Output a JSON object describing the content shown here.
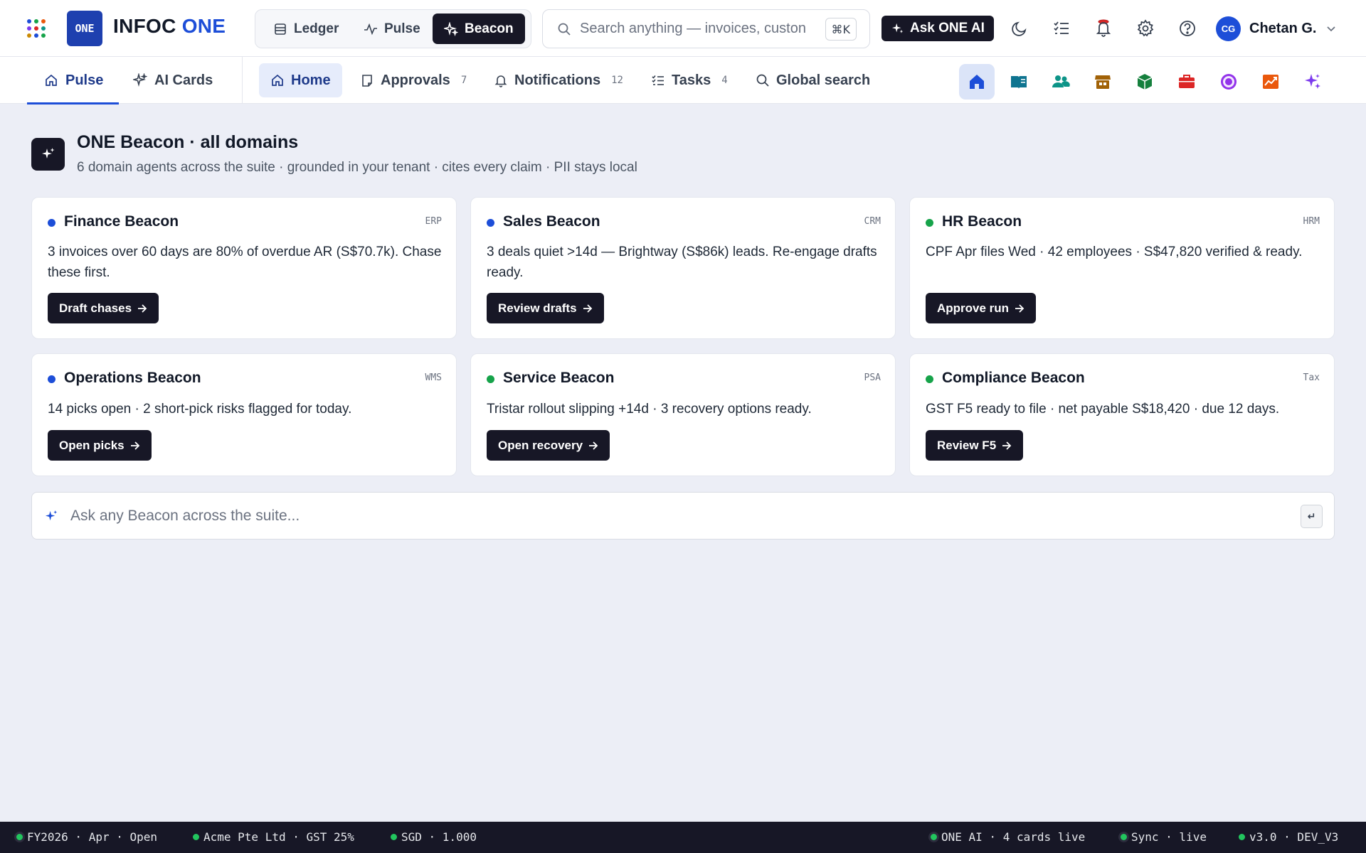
{
  "topbar": {
    "brand_main": "INFOC ",
    "brand_accent": "ONE",
    "logo_text": "ONE",
    "modes": [
      {
        "label": "Ledger",
        "icon": "ledger-icon",
        "active": false
      },
      {
        "label": "Pulse",
        "icon": "pulse-icon",
        "active": false
      },
      {
        "label": "Beacon",
        "icon": "sparkle-icon",
        "active": true
      }
    ],
    "search_placeholder": "Search anything — invoices, custon",
    "search_shortcut": "⌘K",
    "ask_label": "Ask ONE AI",
    "user": {
      "initials": "CG",
      "name": "Chetan G."
    }
  },
  "subnav": {
    "tabs": [
      {
        "label": "Pulse",
        "active": true
      },
      {
        "label": "AI Cards",
        "active": false
      }
    ],
    "items": [
      {
        "label": "Home",
        "count": "",
        "active": true
      },
      {
        "label": "Approvals",
        "count": "7"
      },
      {
        "label": "Notifications",
        "count": "12"
      },
      {
        "label": "Tasks",
        "count": "4"
      },
      {
        "label": "Global search",
        "count": ""
      }
    ],
    "apps": [
      "home",
      "ledger-book",
      "people",
      "store",
      "package",
      "briefcase",
      "circle-user",
      "chart",
      "sparkle"
    ]
  },
  "hero": {
    "title": "ONE Beacon · all domains",
    "subtitle": "6 domain agents across the suite · grounded in your tenant · cites every claim · PII stays local"
  },
  "colors": {
    "blue_dot": "#1d4ed8",
    "green_dot": "#16a34a",
    "dark": "#171726",
    "accent": "#1d4ed8"
  },
  "cards": [
    {
      "title": "Finance Beacon",
      "tag": "ERP",
      "dot": "blue",
      "body": "3 invoices over 60 days are 80% of overdue AR (S$70.7k). Chase these first.",
      "button": "Draft chases"
    },
    {
      "title": "Sales Beacon",
      "tag": "CRM",
      "dot": "blue",
      "body": "3 deals quiet >14d — Brightway (S$86k) leads. Re-engage drafts ready.",
      "button": "Review drafts"
    },
    {
      "title": "HR Beacon",
      "tag": "HRM",
      "dot": "green",
      "body": "CPF Apr files Wed · 42 employees · S$47,820 verified & ready.",
      "button": "Approve run"
    },
    {
      "title": "Operations Beacon",
      "tag": "WMS",
      "dot": "blue",
      "body": "14 picks open · 2 short-pick risks flagged for today.",
      "button": "Open picks"
    },
    {
      "title": "Service Beacon",
      "tag": "PSA",
      "dot": "green",
      "body": "Tristar rollout slipping +14d · 3 recovery options ready.",
      "button": "Open recovery"
    },
    {
      "title": "Compliance Beacon",
      "tag": "Tax",
      "dot": "green",
      "body": "GST F5 ready to file · net payable S$18,420 · due 12 days.",
      "button": "Review F5"
    }
  ],
  "ask": {
    "placeholder": "Ask any Beacon across the suite...",
    "enter_key": "↵"
  },
  "status": {
    "period": "FY2026 · Apr · Open",
    "entity": "Acme Pte Ltd · GST 25%",
    "currency": "SGD · 1.000",
    "ai": "ONE AI · 4 cards live",
    "sync": "Sync · live",
    "version": "v3.0 · DEV_V3"
  }
}
